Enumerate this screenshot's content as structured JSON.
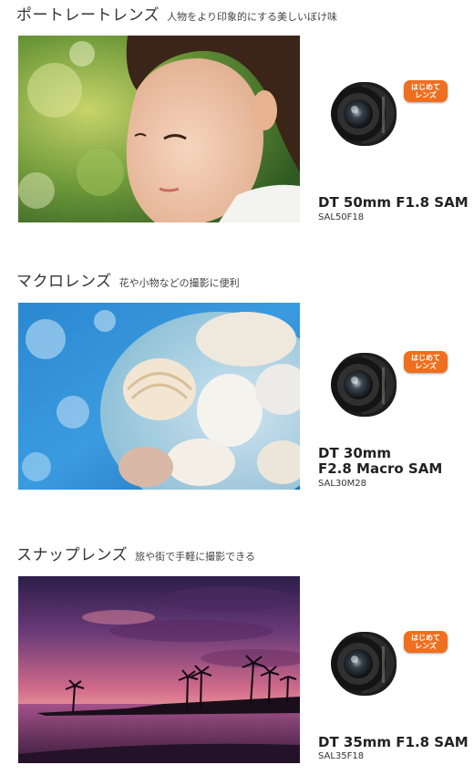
{
  "sections": [
    {
      "title": "ポートレートレンズ",
      "subtitle": "人物をより印象的にする美しいぼけ味",
      "badge_line1": "はじめて",
      "badge_line2": "レンズ",
      "model_line1": "DT 50mm F1.8 SAM",
      "model_line2": "",
      "code": "SAL50F18"
    },
    {
      "title": "マクロレンズ",
      "subtitle": "花や小物などの撮影に便利",
      "badge_line1": "はじめて",
      "badge_line2": "レンズ",
      "model_line1": "DT 30mm",
      "model_line2": "F2.8 Macro SAM",
      "code": "SAL30M28"
    },
    {
      "title": "スナップレンズ",
      "subtitle": "旅や街で手軽に撮影できる",
      "badge_line1": "はじめて",
      "badge_line2": "レンズ",
      "model_line1": "DT 35mm F1.8 SAM",
      "model_line2": "",
      "code": "SAL35F18"
    }
  ],
  "colors": {
    "badge": "#ef6f1e",
    "text": "#222222"
  }
}
